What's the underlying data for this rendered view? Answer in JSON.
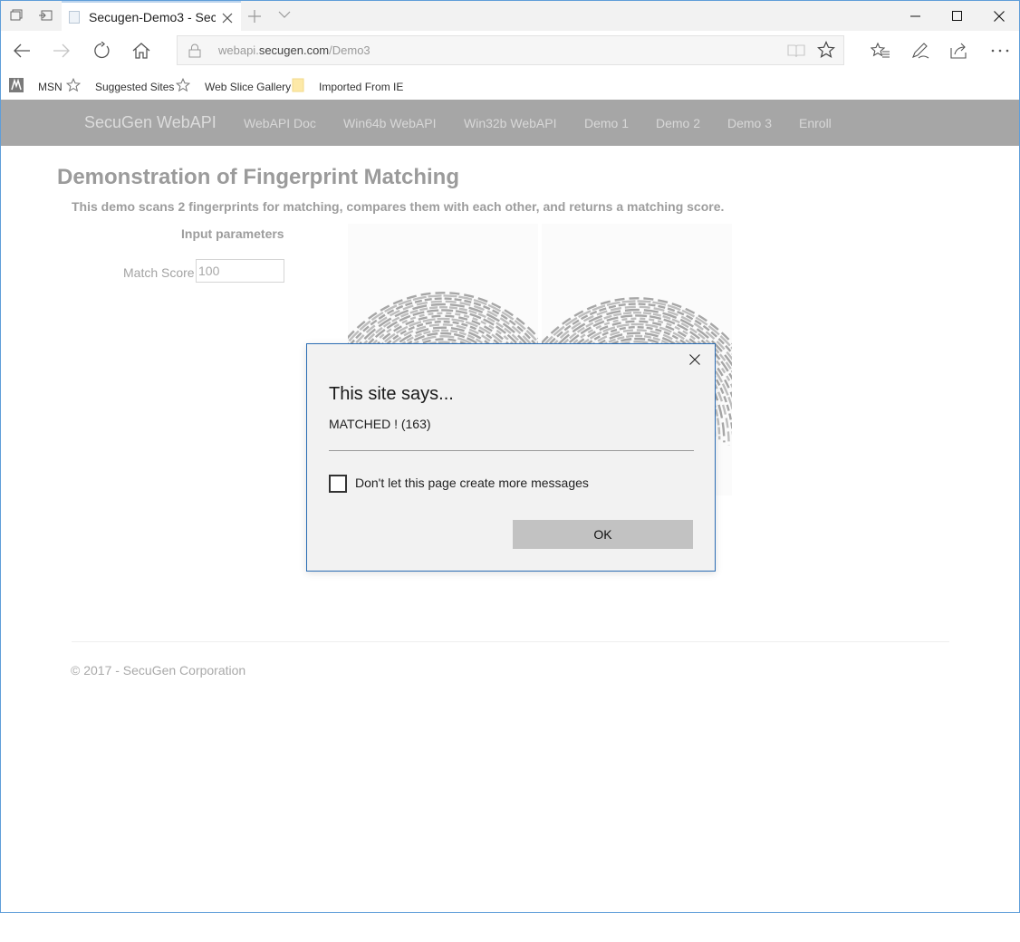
{
  "browser": {
    "tab_title": "Secugen-Demo3 - Secu",
    "address": {
      "prefix": "webapi.",
      "host": "secugen.com",
      "path": "/Demo3"
    },
    "favorites": [
      {
        "label": "MSN",
        "icon": "msn-icon"
      },
      {
        "label": "Suggested Sites",
        "icon": "star-outline-icon"
      },
      {
        "label": "Web Slice Gallery",
        "icon": "star-outline-icon"
      },
      {
        "label": "Imported From IE",
        "icon": "folder-icon"
      }
    ]
  },
  "site": {
    "brand": "SecuGen WebAPI",
    "nav": [
      "WebAPI Doc",
      "Win64b WebAPI",
      "Win32b WebAPI",
      "Demo 1",
      "Demo 2",
      "Demo 3",
      "Enroll"
    ],
    "nav_color": "#a6a6a6"
  },
  "content": {
    "title": "Demonstration of Fingerprint Matching",
    "description": "This demo scans 2 fingerprints for matching, compares them with each other, and returns a matching score.",
    "params_heading": "Input parameters",
    "match_score_label": "Match Score",
    "match_score_value": "100"
  },
  "footer": {
    "copyright": "© 2017 - SecuGen Corporation"
  },
  "dialog": {
    "title": "This site says...",
    "message": "MATCHED ! (163)",
    "checkbox_label": "Don't let this page create more messages",
    "checkbox_checked": false,
    "ok_label": "OK",
    "border_color": "#2b6db4"
  }
}
